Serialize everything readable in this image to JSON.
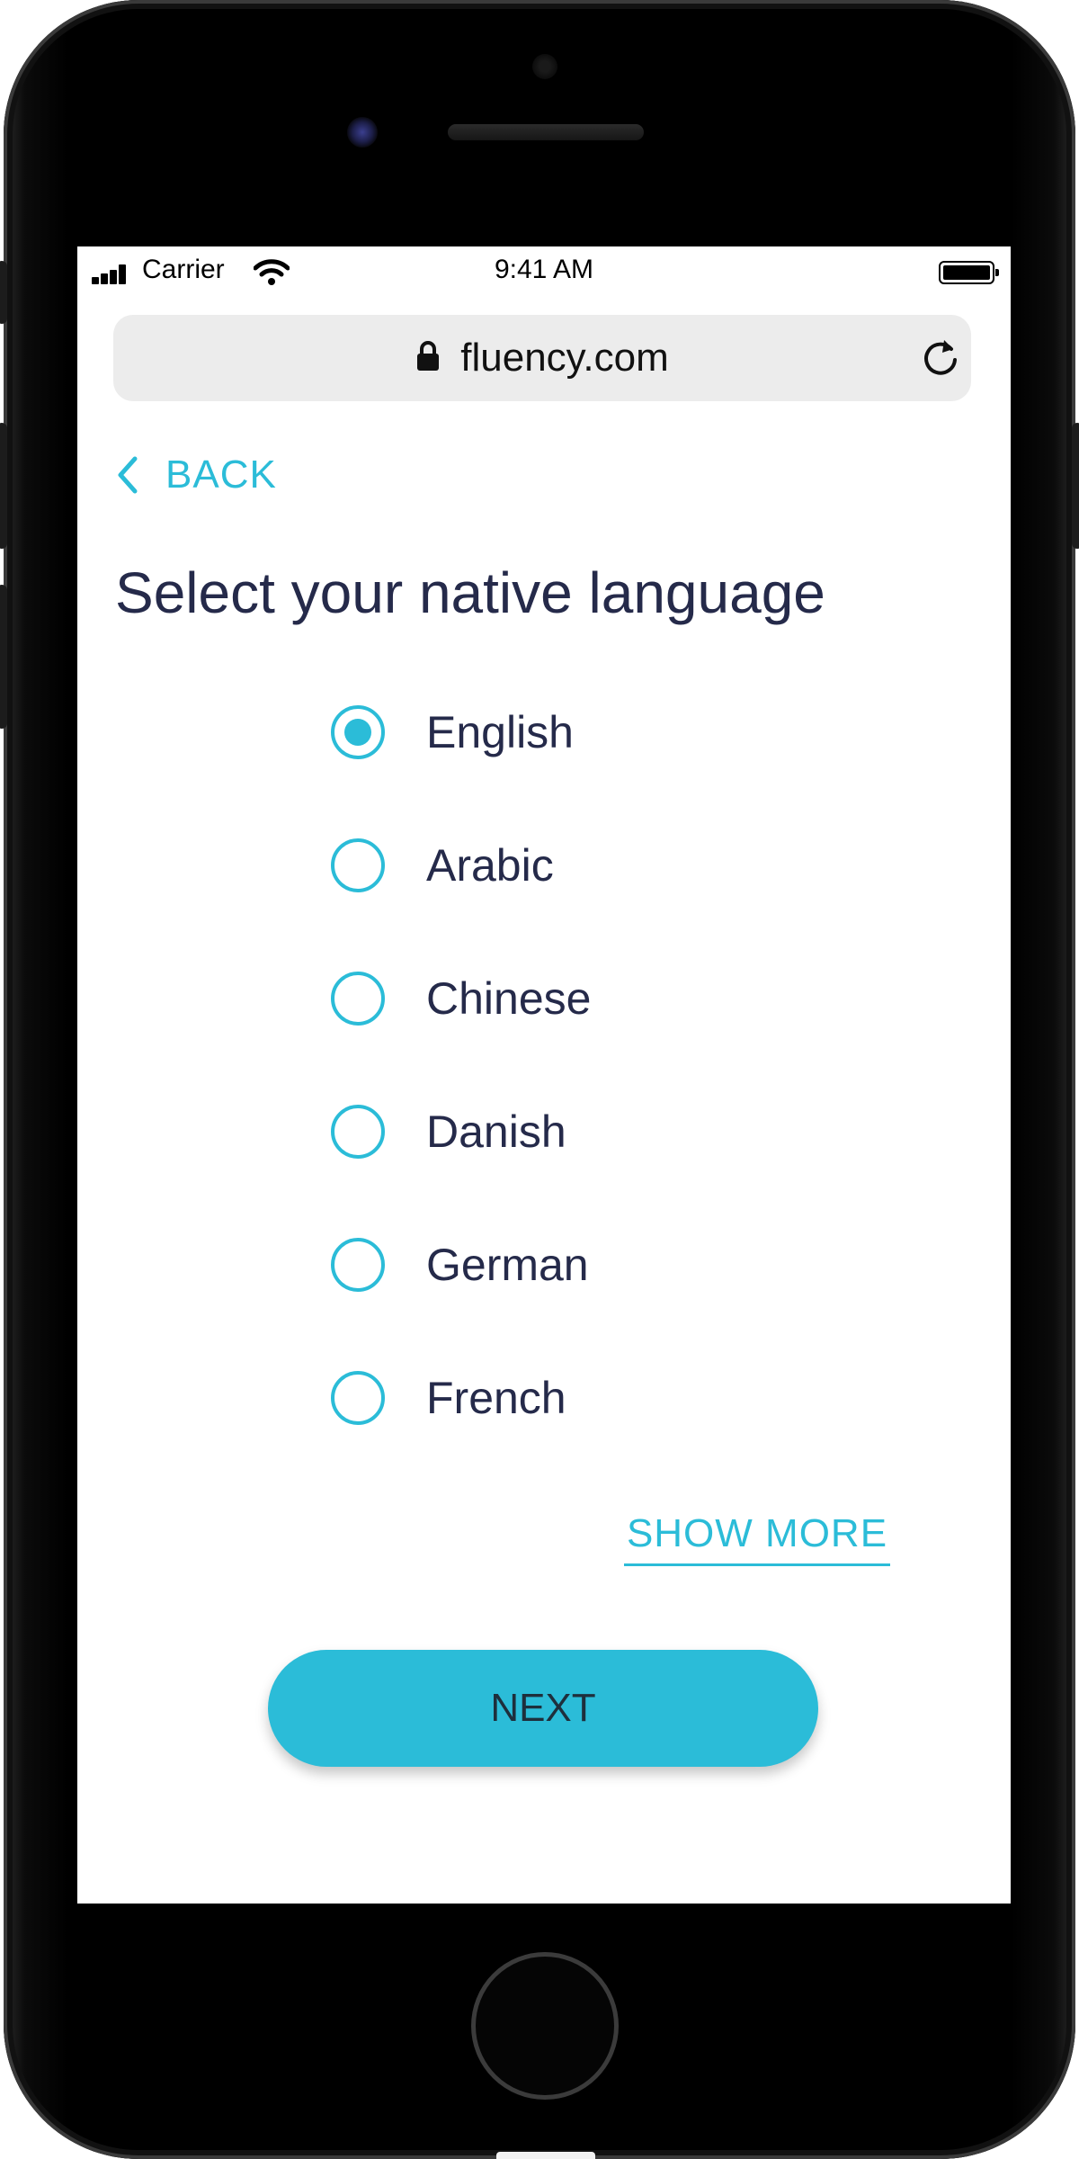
{
  "status_bar": {
    "carrier": "Carrier",
    "time": "9:41 AM",
    "signal_icon": "signal-bars-icon",
    "wifi_icon": "wifi-icon",
    "battery_icon": "battery-full-icon"
  },
  "browser": {
    "url": "fluency.com",
    "lock_icon": "lock-icon",
    "reload_icon": "reload-icon"
  },
  "nav": {
    "back_label": "BACK",
    "back_icon": "chevron-left-icon"
  },
  "page": {
    "title": "Select your native language"
  },
  "languages": [
    {
      "label": "English",
      "selected": true
    },
    {
      "label": "Arabic",
      "selected": false
    },
    {
      "label": "Chinese",
      "selected": false
    },
    {
      "label": "Danish",
      "selected": false
    },
    {
      "label": "German",
      "selected": false
    },
    {
      "label": "French",
      "selected": false
    }
  ],
  "actions": {
    "show_more_label": "SHOW MORE",
    "next_label": "NEXT"
  },
  "colors": {
    "accent": "#2bbcd8",
    "text_dark": "#252a4a",
    "url_bar_bg": "#ececec"
  }
}
